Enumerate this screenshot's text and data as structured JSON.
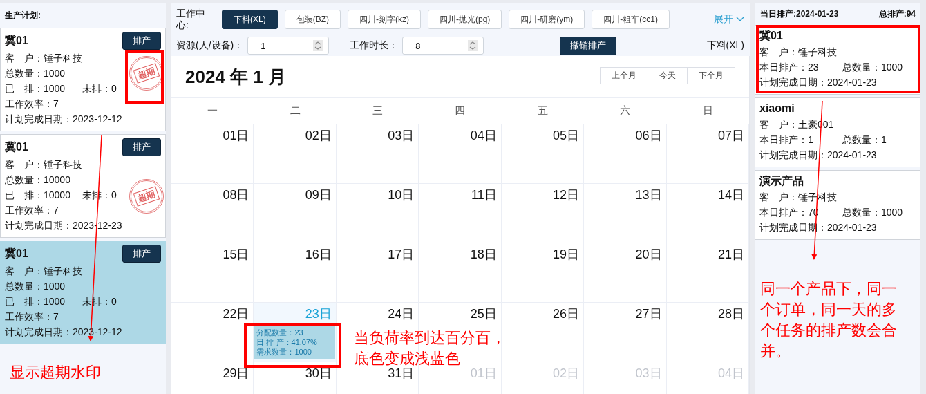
{
  "plan_panel": {
    "title": "生产计划:",
    "orders": [
      {
        "name": "冀01",
        "button": "排产",
        "customer": "客　户：锤子科技",
        "total": "总数量：1000",
        "scheduled": "已　排：1000",
        "unscheduled": "未排：0",
        "efficiency": "工作效率：7",
        "due": "计划完成日期：2023-12-12",
        "overdue": true,
        "stamp": "超期",
        "selected": false
      },
      {
        "name": "冀01",
        "button": "排产",
        "customer": "客　户：锤子科技",
        "total": "总数量：10000",
        "scheduled": "已　排：10000",
        "unscheduled": "未排：0",
        "efficiency": "工作效率：7",
        "due": "计划完成日期：2023-12-23",
        "overdue": true,
        "stamp": "超期",
        "selected": false
      },
      {
        "name": "冀01",
        "button": "排产",
        "customer": "客　户：锤子科技",
        "total": "总数量：1000",
        "scheduled": "已　排：1000",
        "unscheduled": "未排：0",
        "efficiency": "工作效率：7",
        "due": "计划完成日期：2023-12-12",
        "overdue": false,
        "selected": true
      }
    ]
  },
  "toolbar": {
    "work_center_label": "工作中心:",
    "tabs": [
      {
        "label": "下料(XL)",
        "selected": true
      },
      {
        "label": "包装(BZ)",
        "selected": false
      },
      {
        "label": "四川-刻字(kz)",
        "selected": false
      },
      {
        "label": "四川-抛光(pg)",
        "selected": false
      },
      {
        "label": "四川-研磨(ym)",
        "selected": false
      },
      {
        "label": "四川-粗车(cc1)",
        "selected": false
      }
    ],
    "expand": "展开",
    "resource_label": "资源(人/设备)：",
    "resource_value": "1",
    "hours_label": "工作时长：",
    "hours_value": "8",
    "cancel_button": "撤销排产",
    "current_center": "下料(XL)"
  },
  "calendar": {
    "title": "2024 年 1 月",
    "nav": [
      "上个月",
      "今天",
      "下个月"
    ],
    "weekdays": [
      "一",
      "二",
      "三",
      "四",
      "五",
      "六",
      "日"
    ],
    "weeks": [
      [
        {
          "label": "01日",
          "other_month": false,
          "today": false
        },
        {
          "label": "02日",
          "other_month": false,
          "today": false
        },
        {
          "label": "03日",
          "other_month": false,
          "today": false
        },
        {
          "label": "04日",
          "other_month": false,
          "today": false
        },
        {
          "label": "05日",
          "other_month": false,
          "today": false
        },
        {
          "label": "06日",
          "other_month": false,
          "today": false
        },
        {
          "label": "07日",
          "other_month": false,
          "today": false
        }
      ],
      [
        {
          "label": "08日",
          "other_month": false,
          "today": false
        },
        {
          "label": "09日",
          "other_month": false,
          "today": false
        },
        {
          "label": "10日",
          "other_month": false,
          "today": false
        },
        {
          "label": "11日",
          "other_month": false,
          "today": false
        },
        {
          "label": "12日",
          "other_month": false,
          "today": false
        },
        {
          "label": "13日",
          "other_month": false,
          "today": false
        },
        {
          "label": "14日",
          "other_month": false,
          "today": false
        }
      ],
      [
        {
          "label": "15日",
          "other_month": false,
          "today": false
        },
        {
          "label": "16日",
          "other_month": false,
          "today": false
        },
        {
          "label": "17日",
          "other_month": false,
          "today": false
        },
        {
          "label": "18日",
          "other_month": false,
          "today": false
        },
        {
          "label": "19日",
          "other_month": false,
          "today": false
        },
        {
          "label": "20日",
          "other_month": false,
          "today": false
        },
        {
          "label": "21日",
          "other_month": false,
          "today": false
        }
      ],
      [
        {
          "label": "22日",
          "other_month": false,
          "today": false
        },
        {
          "label": "23日",
          "other_month": false,
          "today": true,
          "task": {
            "allocated": "分配数量：23",
            "daily_rate": "日 排 产：41.07%",
            "demand": "需求数量：1000"
          }
        },
        {
          "label": "24日",
          "other_month": false,
          "today": false
        },
        {
          "label": "25日",
          "other_month": false,
          "today": false
        },
        {
          "label": "26日",
          "other_month": false,
          "today": false
        },
        {
          "label": "27日",
          "other_month": false,
          "today": false
        },
        {
          "label": "28日",
          "other_month": false,
          "today": false
        }
      ],
      [
        {
          "label": "29日",
          "other_month": false,
          "today": false
        },
        {
          "label": "30日",
          "other_month": false,
          "today": false
        },
        {
          "label": "31日",
          "other_month": false,
          "today": false
        },
        {
          "label": "01日",
          "other_month": true,
          "today": false
        },
        {
          "label": "02日",
          "other_month": true,
          "today": false
        },
        {
          "label": "03日",
          "other_month": true,
          "today": false
        },
        {
          "label": "04日",
          "other_month": true,
          "today": false
        }
      ]
    ]
  },
  "day_panel": {
    "date_title": "当日排产:2024-01-23",
    "total_title": "总排产:94",
    "cards": [
      {
        "name": "冀01",
        "customer": "客　户：锤子科技",
        "today_count": "本日排产：23",
        "total": "总数量：1000",
        "due": "计划完成日期：2024-01-23"
      },
      {
        "name": "xiaomi",
        "customer": "客　户：土豪001",
        "today_count": "本日排产：1",
        "total": "总数量：1",
        "due": "计划完成日期：2024-01-23"
      },
      {
        "name": "演示产品",
        "customer": "客　户：锤子科技",
        "today_count": "本日排产：70",
        "total": "总数量：1000",
        "due": "计划完成日期：2024-01-23"
      }
    ]
  },
  "annotations": [
    {
      "lines": [
        "显示超期水印"
      ]
    },
    {
      "lines": [
        "当负荷率到达百分百，",
        "底色变成浅蓝色"
      ]
    },
    {
      "lines": [
        "同一个产品下，同一",
        "个订单，同一天的多",
        "个任务的排产数会合",
        "并。"
      ]
    }
  ]
}
